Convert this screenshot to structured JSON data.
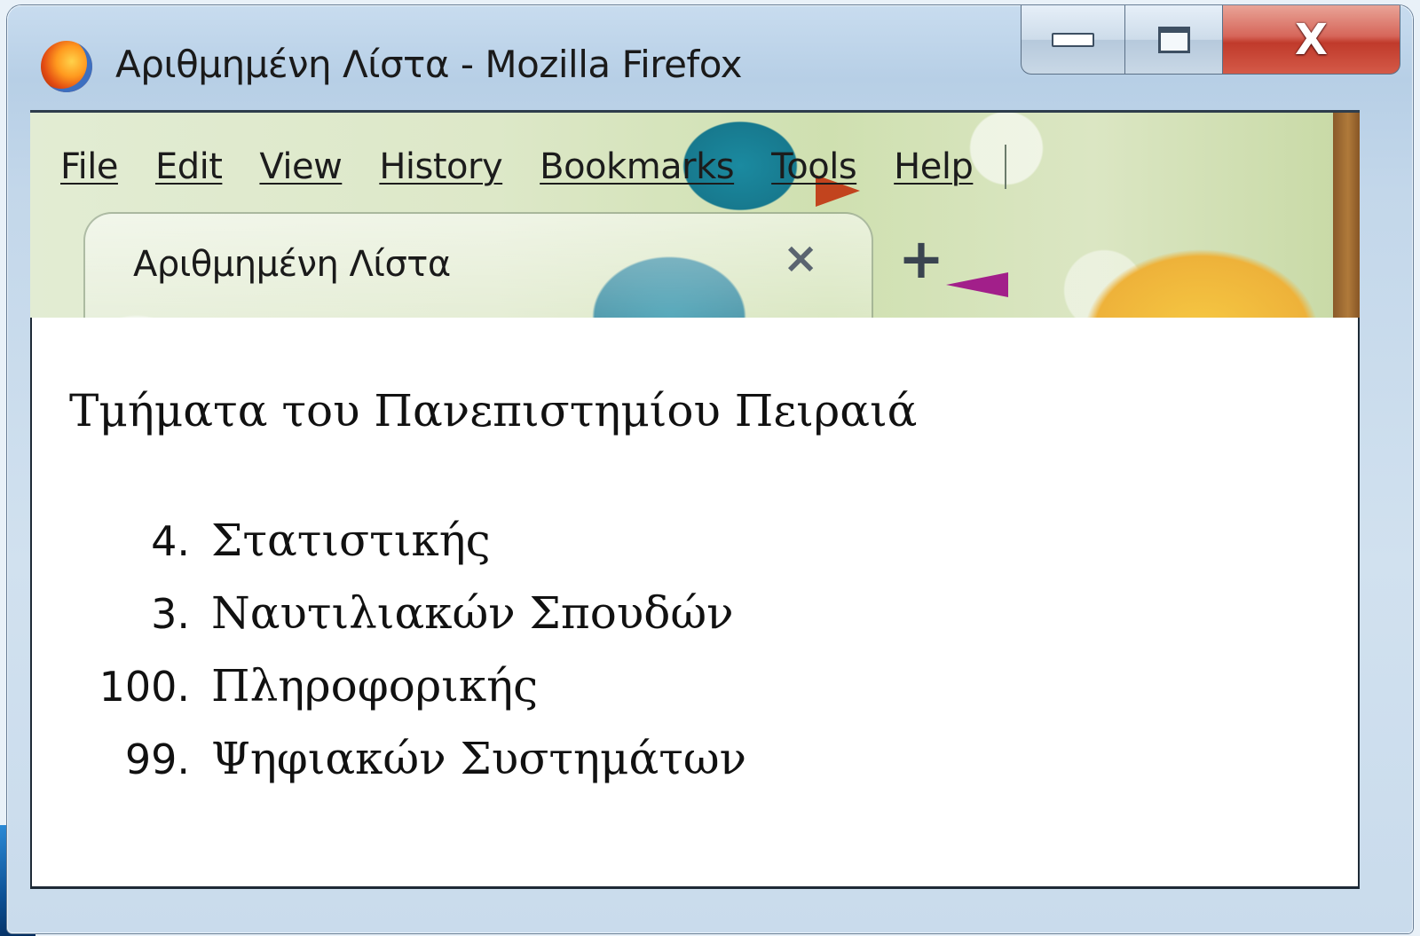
{
  "window": {
    "title": "Αριθμημένη Λίστα - Mozilla Firefox"
  },
  "icons": {
    "app": "firefox-logo",
    "minimize": "minimize-icon",
    "maximize": "maximize-icon",
    "close": "close-icon",
    "tab_close": "close-icon",
    "new_tab": "plus-icon"
  },
  "caption_buttons": {
    "close_glyph": "X"
  },
  "menubar": {
    "items": [
      "File",
      "Edit",
      "View",
      "History",
      "Bookmarks",
      "Tools",
      "Help"
    ]
  },
  "tabs": [
    {
      "label": "Αριθμημένη Λίστα",
      "close_glyph": "×"
    }
  ],
  "new_tab_glyph": "+",
  "page": {
    "heading": "Τμήματα του Πανεπιστημίου Πειραιά",
    "list": [
      {
        "number": "4.",
        "text": "Στατιστικής"
      },
      {
        "number": "3.",
        "text": "Ναυτιλιακών Σπουδών"
      },
      {
        "number": "100.",
        "text": "Πληροφορικής"
      },
      {
        "number": "99.",
        "text": "Ψηφιακών Συστημάτων"
      }
    ]
  },
  "colors": {
    "close_button": "#c03a2b",
    "frame": "#c8dcef"
  }
}
